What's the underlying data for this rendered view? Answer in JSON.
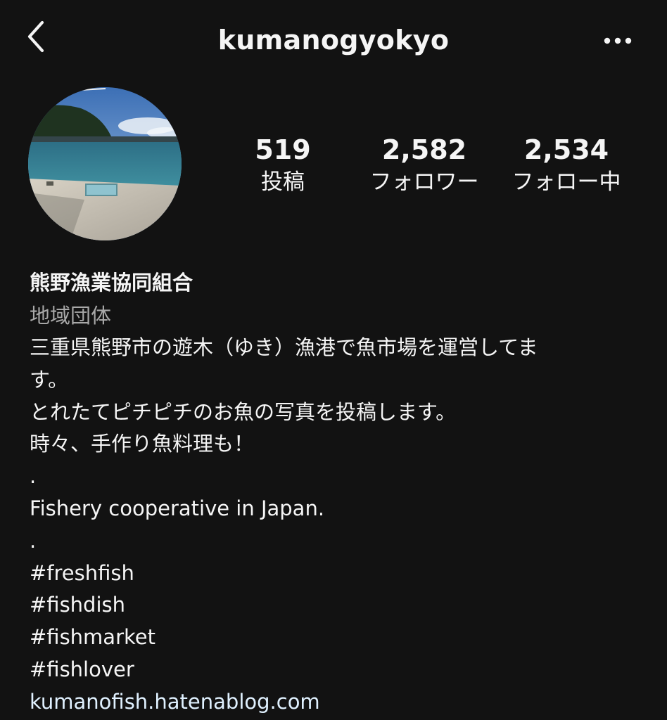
{
  "header": {
    "username": "kumanogyokyo",
    "back_icon": "chevron-left-icon",
    "more_icon": "more-horizontal-icon"
  },
  "profile": {
    "avatar": "profile-photo-harbor",
    "stats": {
      "posts": {
        "value": "519",
        "label": "投稿"
      },
      "followers": {
        "value": "2,582",
        "label": "フォロワー"
      },
      "following": {
        "value": "2,534",
        "label": "フォロー中"
      }
    }
  },
  "bio": {
    "name": "熊野漁業協同組合",
    "category": "地域団体",
    "lines": [
      "三重県熊野市の遊木（ゆき）漁港で魚市場を運営してま",
      "す。",
      "とれたてピチピチのお魚の写真を投稿します。",
      "時々、手作り魚料理も！",
      ".",
      "Fishery cooperative in Japan.",
      ".",
      "#freshfish",
      "#fishdish",
      "#fishmarket",
      "#fishlover"
    ],
    "link": "kumanofish.hatenablog.com"
  },
  "colors": {
    "background": "#121212",
    "text": "#f5f5f5",
    "secondary_text": "#a8a8a8"
  }
}
